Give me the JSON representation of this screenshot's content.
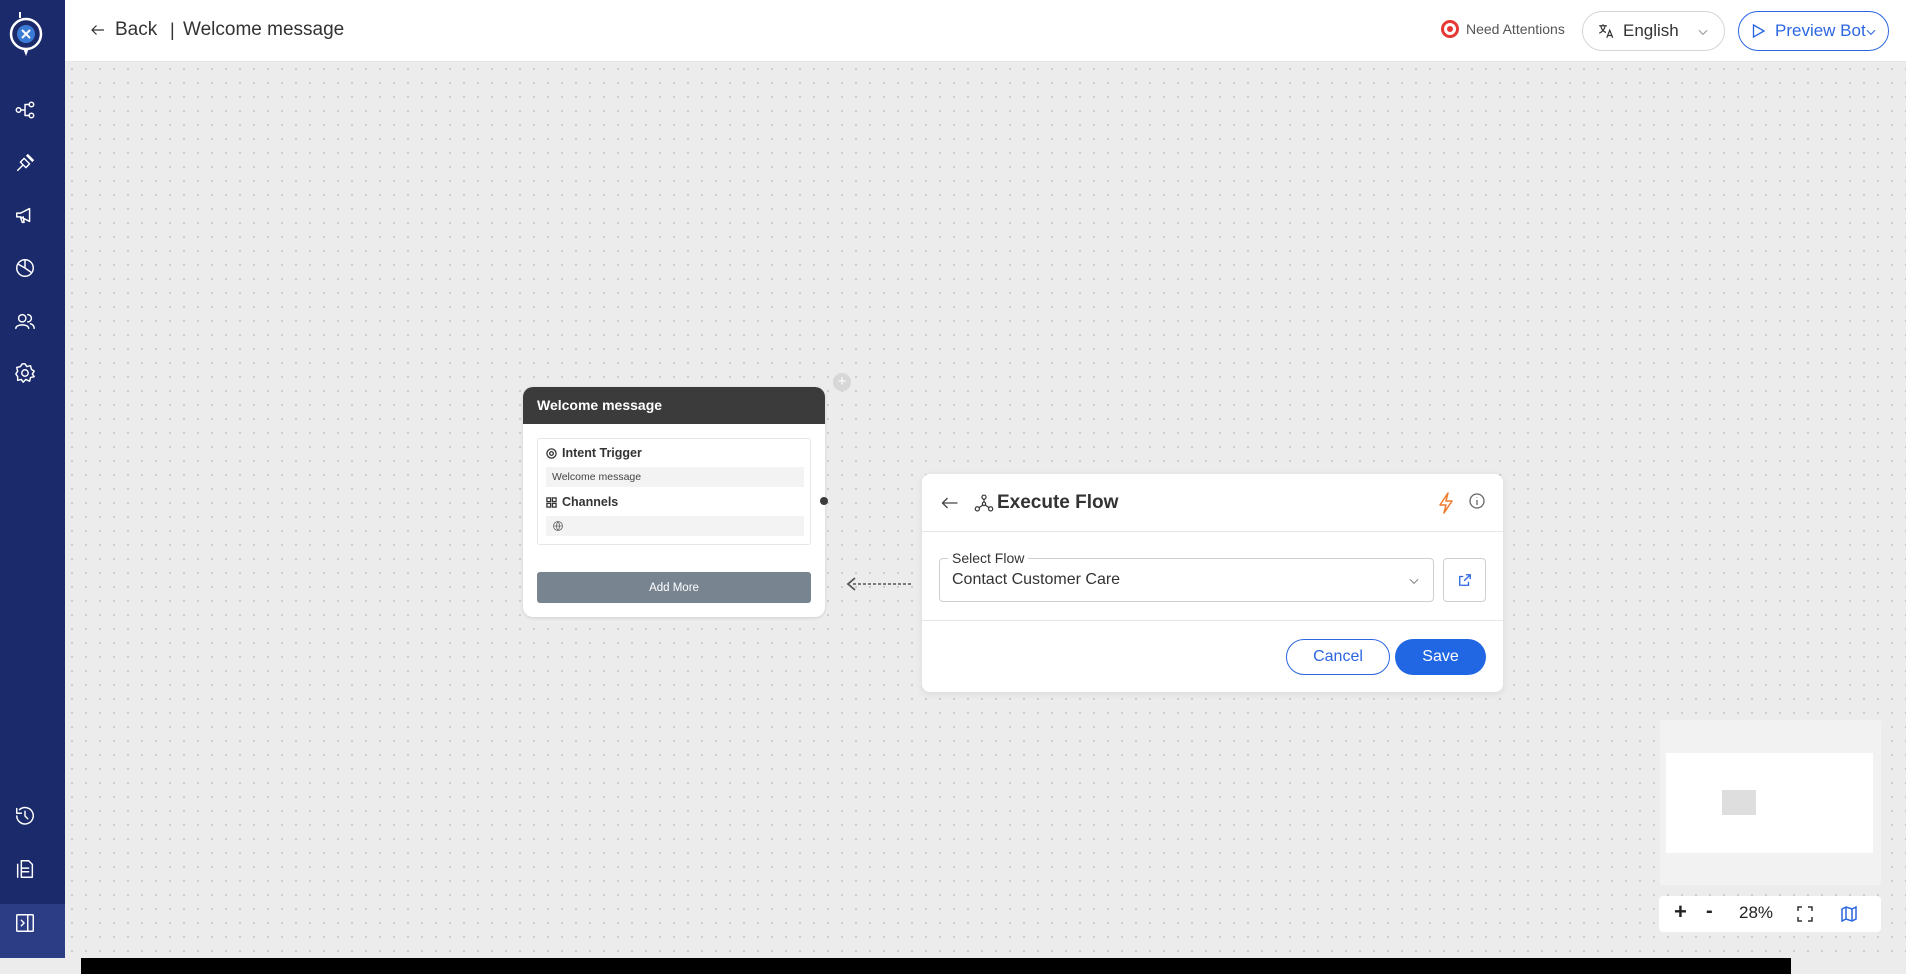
{
  "header": {
    "back_label": "Back",
    "separator": "|",
    "title": "Welcome message",
    "attention_label": "Need Attentions",
    "language": "English",
    "preview_label": "Preview Bot"
  },
  "sidebar": {
    "items": [
      {
        "icon": "flow-icon"
      },
      {
        "icon": "integration-icon"
      },
      {
        "icon": "broadcast-icon"
      },
      {
        "icon": "analytics-icon"
      },
      {
        "icon": "users-icon"
      },
      {
        "icon": "settings-icon"
      },
      {
        "icon": "history-icon"
      },
      {
        "icon": "document-icon"
      },
      {
        "icon": "collapse-panel-icon"
      }
    ]
  },
  "node": {
    "title": "Welcome message",
    "trigger_label": "Intent Trigger",
    "trigger_value": "Welcome message",
    "channels_label": "Channels",
    "add_more_label": "Add More"
  },
  "panel": {
    "title": "Execute Flow",
    "select_label": "Select Flow",
    "select_value": "Contact Customer Care",
    "cancel_label": "Cancel",
    "save_label": "Save"
  },
  "zoom": {
    "plus": "+",
    "minus": "-",
    "level": "28%"
  },
  "colors": {
    "sidebar": "#1b2a6b",
    "accent": "#2166e3",
    "node_header": "#3b3b3b",
    "attention": "#e53935",
    "bolt": "#f07a2b"
  }
}
